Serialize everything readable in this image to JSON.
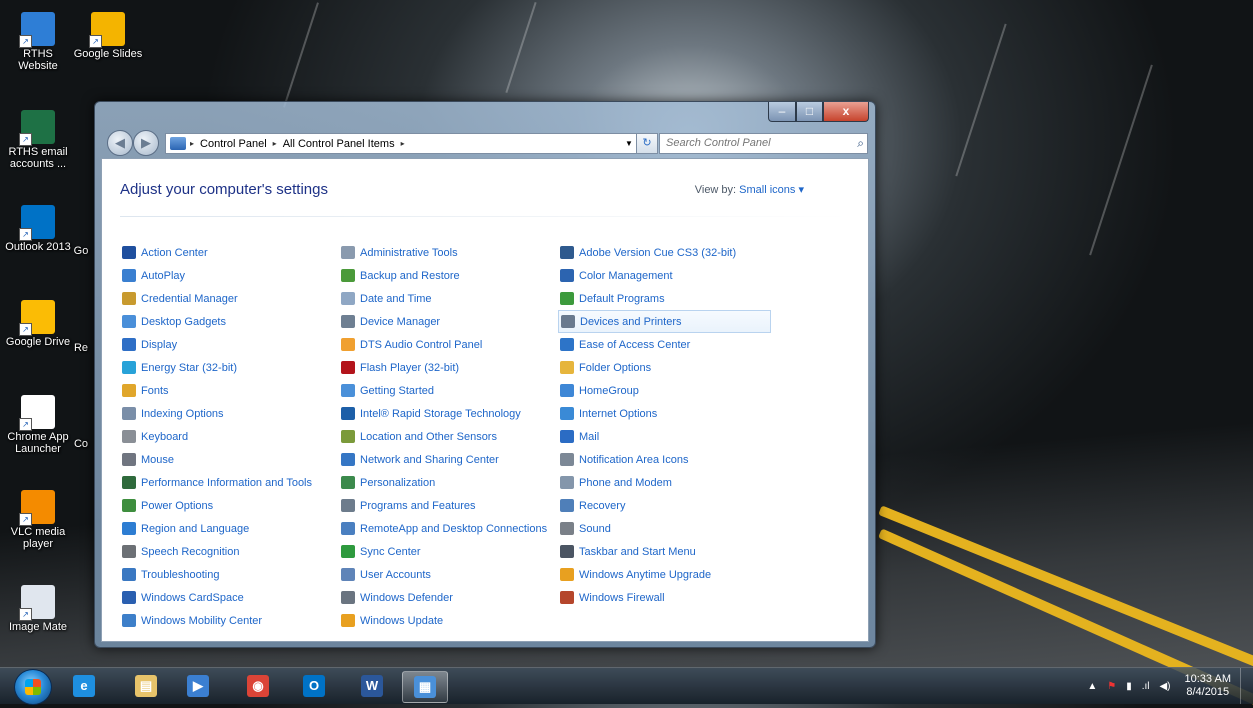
{
  "desktop": {
    "icons": [
      {
        "label": "RTHS Website",
        "color": "#2e7ed6"
      },
      {
        "label": "Google Slides",
        "color": "#f4b400"
      },
      {
        "label": "RTHS email accounts ...",
        "color": "#1e7145"
      },
      {
        "label": "Outlook 2013",
        "color": "#0072c6"
      },
      {
        "label": "Google Drive",
        "color": "#fbbc05"
      },
      {
        "label": "Chrome App Launcher",
        "color": "#ffffff"
      },
      {
        "label": "VLC media player",
        "color": "#f48b00"
      },
      {
        "label": "Image Mate",
        "color": "#e0e6ee"
      }
    ],
    "partial_labels": [
      "Go",
      "Re",
      "Co"
    ]
  },
  "window": {
    "controls": {
      "minimize": "–",
      "maximize": "□",
      "close": "x"
    },
    "nav": {
      "back": "◀",
      "forward": "▶"
    },
    "breadcrumb": [
      "Control Panel",
      "All Control Panel Items"
    ],
    "breadcrumb_sep": "▸",
    "search_placeholder": "Search Control Panel",
    "heading": "Adjust your computer's settings",
    "view_by_label": "View by:",
    "view_by_value": "Small icons",
    "columns": [
      [
        {
          "label": "Action Center",
          "icon": "flag-icon",
          "color": "#1f4f9e"
        },
        {
          "label": "AutoPlay",
          "icon": "autoplay-icon",
          "color": "#3a7fd0"
        },
        {
          "label": "Credential Manager",
          "icon": "vault-icon",
          "color": "#c89a2e"
        },
        {
          "label": "Desktop Gadgets",
          "icon": "gadget-icon",
          "color": "#4a8fd9"
        },
        {
          "label": "Display",
          "icon": "display-icon",
          "color": "#2f6fc6"
        },
        {
          "label": "Energy Star (32-bit)",
          "icon": "energy-star-icon",
          "color": "#28a2d8"
        },
        {
          "label": "Fonts",
          "icon": "fonts-icon",
          "color": "#e0a62b"
        },
        {
          "label": "Indexing Options",
          "icon": "indexing-icon",
          "color": "#7a8ea8"
        },
        {
          "label": "Keyboard",
          "icon": "keyboard-icon",
          "color": "#8a8f96"
        },
        {
          "label": "Mouse",
          "icon": "mouse-icon",
          "color": "#707580"
        },
        {
          "label": "Performance Information and Tools",
          "icon": "performance-icon",
          "color": "#2f6a3c"
        },
        {
          "label": "Power Options",
          "icon": "power-icon",
          "color": "#3e8e3e"
        },
        {
          "label": "Region and Language",
          "icon": "globe-icon",
          "color": "#2d7dd2"
        },
        {
          "label": "Speech Recognition",
          "icon": "microphone-icon",
          "color": "#6c7075"
        },
        {
          "label": "Troubleshooting",
          "icon": "troubleshoot-icon",
          "color": "#3a78c2"
        },
        {
          "label": "Windows CardSpace",
          "icon": "cardspace-icon",
          "color": "#2a5fb0"
        },
        {
          "label": "Windows Mobility Center",
          "icon": "mobility-icon",
          "color": "#3d7fc9"
        }
      ],
      [
        {
          "label": "Administrative Tools",
          "icon": "admin-tools-icon",
          "color": "#8a9aae"
        },
        {
          "label": "Backup and Restore",
          "icon": "backup-icon",
          "color": "#4b9a3a"
        },
        {
          "label": "Date and Time",
          "icon": "clock-icon",
          "color": "#8fa7c4"
        },
        {
          "label": "Device Manager",
          "icon": "device-manager-icon",
          "color": "#6e7f92"
        },
        {
          "label": "DTS Audio Control Panel",
          "icon": "audio-icon",
          "color": "#f0a030"
        },
        {
          "label": "Flash Player (32-bit)",
          "icon": "flash-icon",
          "color": "#b3141b"
        },
        {
          "label": "Getting Started",
          "icon": "getting-started-icon",
          "color": "#4a90d9"
        },
        {
          "label": "Intel® Rapid Storage Technology",
          "icon": "intel-storage-icon",
          "color": "#1d5fa8"
        },
        {
          "label": "Location and Other Sensors",
          "icon": "sensor-icon",
          "color": "#7b9a3a"
        },
        {
          "label": "Network and Sharing Center",
          "icon": "network-icon",
          "color": "#3576c4"
        },
        {
          "label": "Personalization",
          "icon": "personalization-icon",
          "color": "#3c8a4c"
        },
        {
          "label": "Programs and Features",
          "icon": "programs-icon",
          "color": "#6d7c8c"
        },
        {
          "label": "RemoteApp and Desktop Connections",
          "icon": "remoteapp-icon",
          "color": "#4a7fc0"
        },
        {
          "label": "Sync Center",
          "icon": "sync-icon",
          "color": "#2e9a3e"
        },
        {
          "label": "User Accounts",
          "icon": "users-icon",
          "color": "#5f84b8"
        },
        {
          "label": "Windows Defender",
          "icon": "defender-icon",
          "color": "#6a7480"
        },
        {
          "label": "Windows Update",
          "icon": "update-icon",
          "color": "#e8a020"
        }
      ],
      [
        {
          "label": "Adobe Version Cue CS3 (32-bit)",
          "icon": "adobe-icon",
          "color": "#2f5a8e"
        },
        {
          "label": "Color Management",
          "icon": "color-management-icon",
          "color": "#2c64b0"
        },
        {
          "label": "Default Programs",
          "icon": "default-programs-icon",
          "color": "#3c9a3c"
        },
        {
          "label": "Devices and Printers",
          "icon": "printer-icon",
          "color": "#6a7a8e"
        },
        {
          "label": "Ease of Access Center",
          "icon": "ease-of-access-icon",
          "color": "#2d74c8"
        },
        {
          "label": "Folder Options",
          "icon": "folder-icon",
          "color": "#e6b53c"
        },
        {
          "label": "HomeGroup",
          "icon": "homegroup-icon",
          "color": "#3e87d6"
        },
        {
          "label": "Internet Options",
          "icon": "internet-options-icon",
          "color": "#3a8ad6"
        },
        {
          "label": "Mail",
          "icon": "mail-icon",
          "color": "#2b6cc4"
        },
        {
          "label": "Notification Area Icons",
          "icon": "notification-icon",
          "color": "#7c8896"
        },
        {
          "label": "Phone and Modem",
          "icon": "phone-icon",
          "color": "#8496ab"
        },
        {
          "label": "Recovery",
          "icon": "recovery-icon",
          "color": "#4f7fb9"
        },
        {
          "label": "Sound",
          "icon": "speaker-icon",
          "color": "#7a8088"
        },
        {
          "label": "Taskbar and Start Menu",
          "icon": "taskbar-icon",
          "color": "#4b5563"
        },
        {
          "label": "Windows Anytime Upgrade",
          "icon": "upgrade-icon",
          "color": "#e8a020"
        },
        {
          "label": "Windows Firewall",
          "icon": "firewall-icon",
          "color": "#b5462c"
        }
      ]
    ],
    "selected_item": "Devices and Printers"
  },
  "taskbar": {
    "pinned": [
      {
        "name": "internet-explorer",
        "glyph": "e",
        "color": "#1e8fe0"
      },
      {
        "name": "file-explorer",
        "glyph": "▤",
        "color": "#e7c36a"
      },
      {
        "name": "media-center",
        "glyph": "▶",
        "color": "#3b7fd1"
      },
      {
        "name": "chrome",
        "glyph": "◉",
        "color": "#db4437"
      },
      {
        "name": "outlook",
        "glyph": "O",
        "color": "#0072c6"
      },
      {
        "name": "word",
        "glyph": "W",
        "color": "#2b579a"
      },
      {
        "name": "control-panel",
        "glyph": "▦",
        "color": "#4a90d9"
      }
    ],
    "tray": {
      "up_arrow": "▲",
      "flag": "⚑",
      "battery": "▮",
      "signal": ".ıl",
      "volume": "◀)"
    },
    "clock_time": "10:33 AM",
    "clock_date": "8/4/2015"
  }
}
